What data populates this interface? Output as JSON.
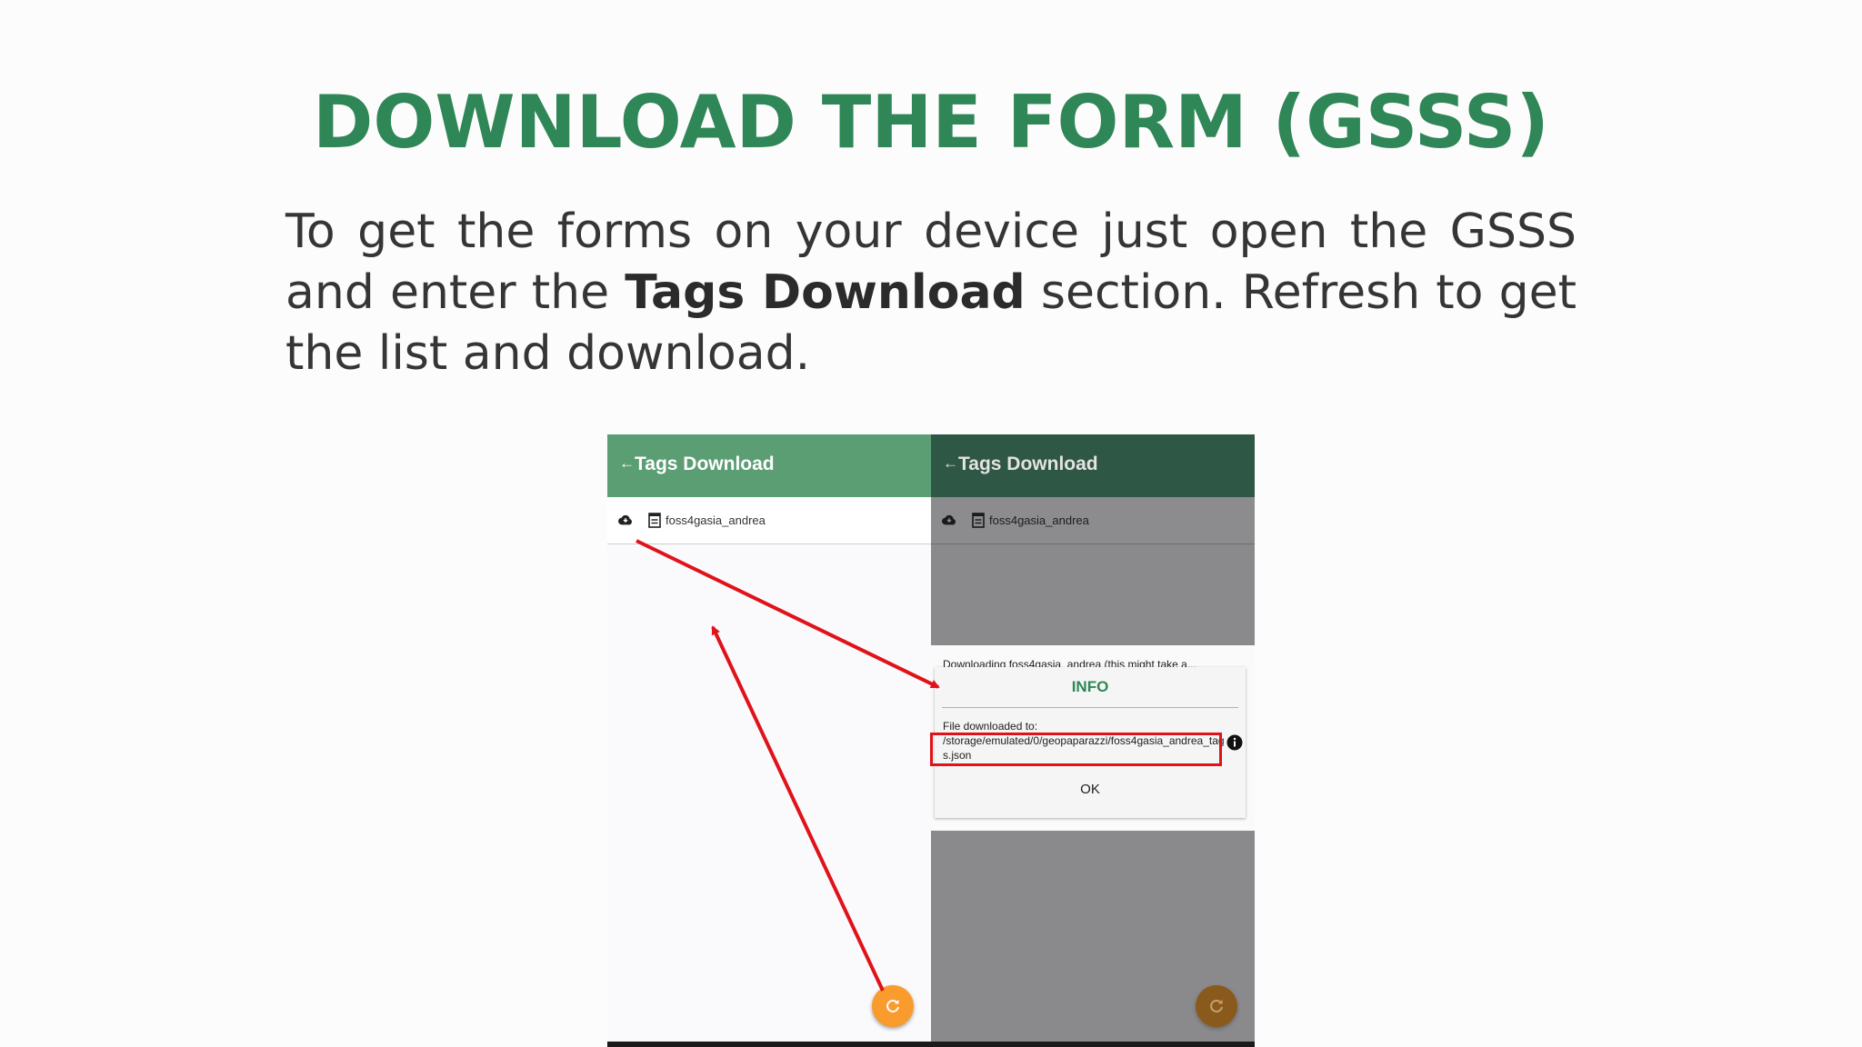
{
  "slide": {
    "title": "DOWNLOAD THE FORM (GSSS)",
    "body_part1": "To get the forms on your device just open the GSSS and enter the ",
    "body_bold": "Tags Download",
    "body_part2": " section. Refresh to get the list and download."
  },
  "left_screen": {
    "appbar": {
      "back_symbol": "←",
      "title": "Tags Download"
    },
    "list_item": {
      "label": "foss4gasia_andrea"
    },
    "fab": {
      "icon": "refresh-icon"
    }
  },
  "right_screen": {
    "appbar": {
      "back_symbol": "←",
      "title": "Tags Download"
    },
    "list_item": {
      "label": "foss4gasia_andrea"
    },
    "downloading_text": "Downloading foss4gasia_andrea (this might take a...",
    "dialog": {
      "title": "INFO",
      "label": "File downloaded to:",
      "path": "/storage/emulated/0/geopaparazzi/foss4gasia_andrea_tags.json",
      "ok": "OK"
    },
    "fab": {
      "icon": "refresh-icon"
    }
  },
  "colors": {
    "title_green": "#2f8656",
    "appbar_green": "#5c9e73",
    "annotation_red": "#e0121a",
    "fab_orange": "#f99b2d"
  }
}
